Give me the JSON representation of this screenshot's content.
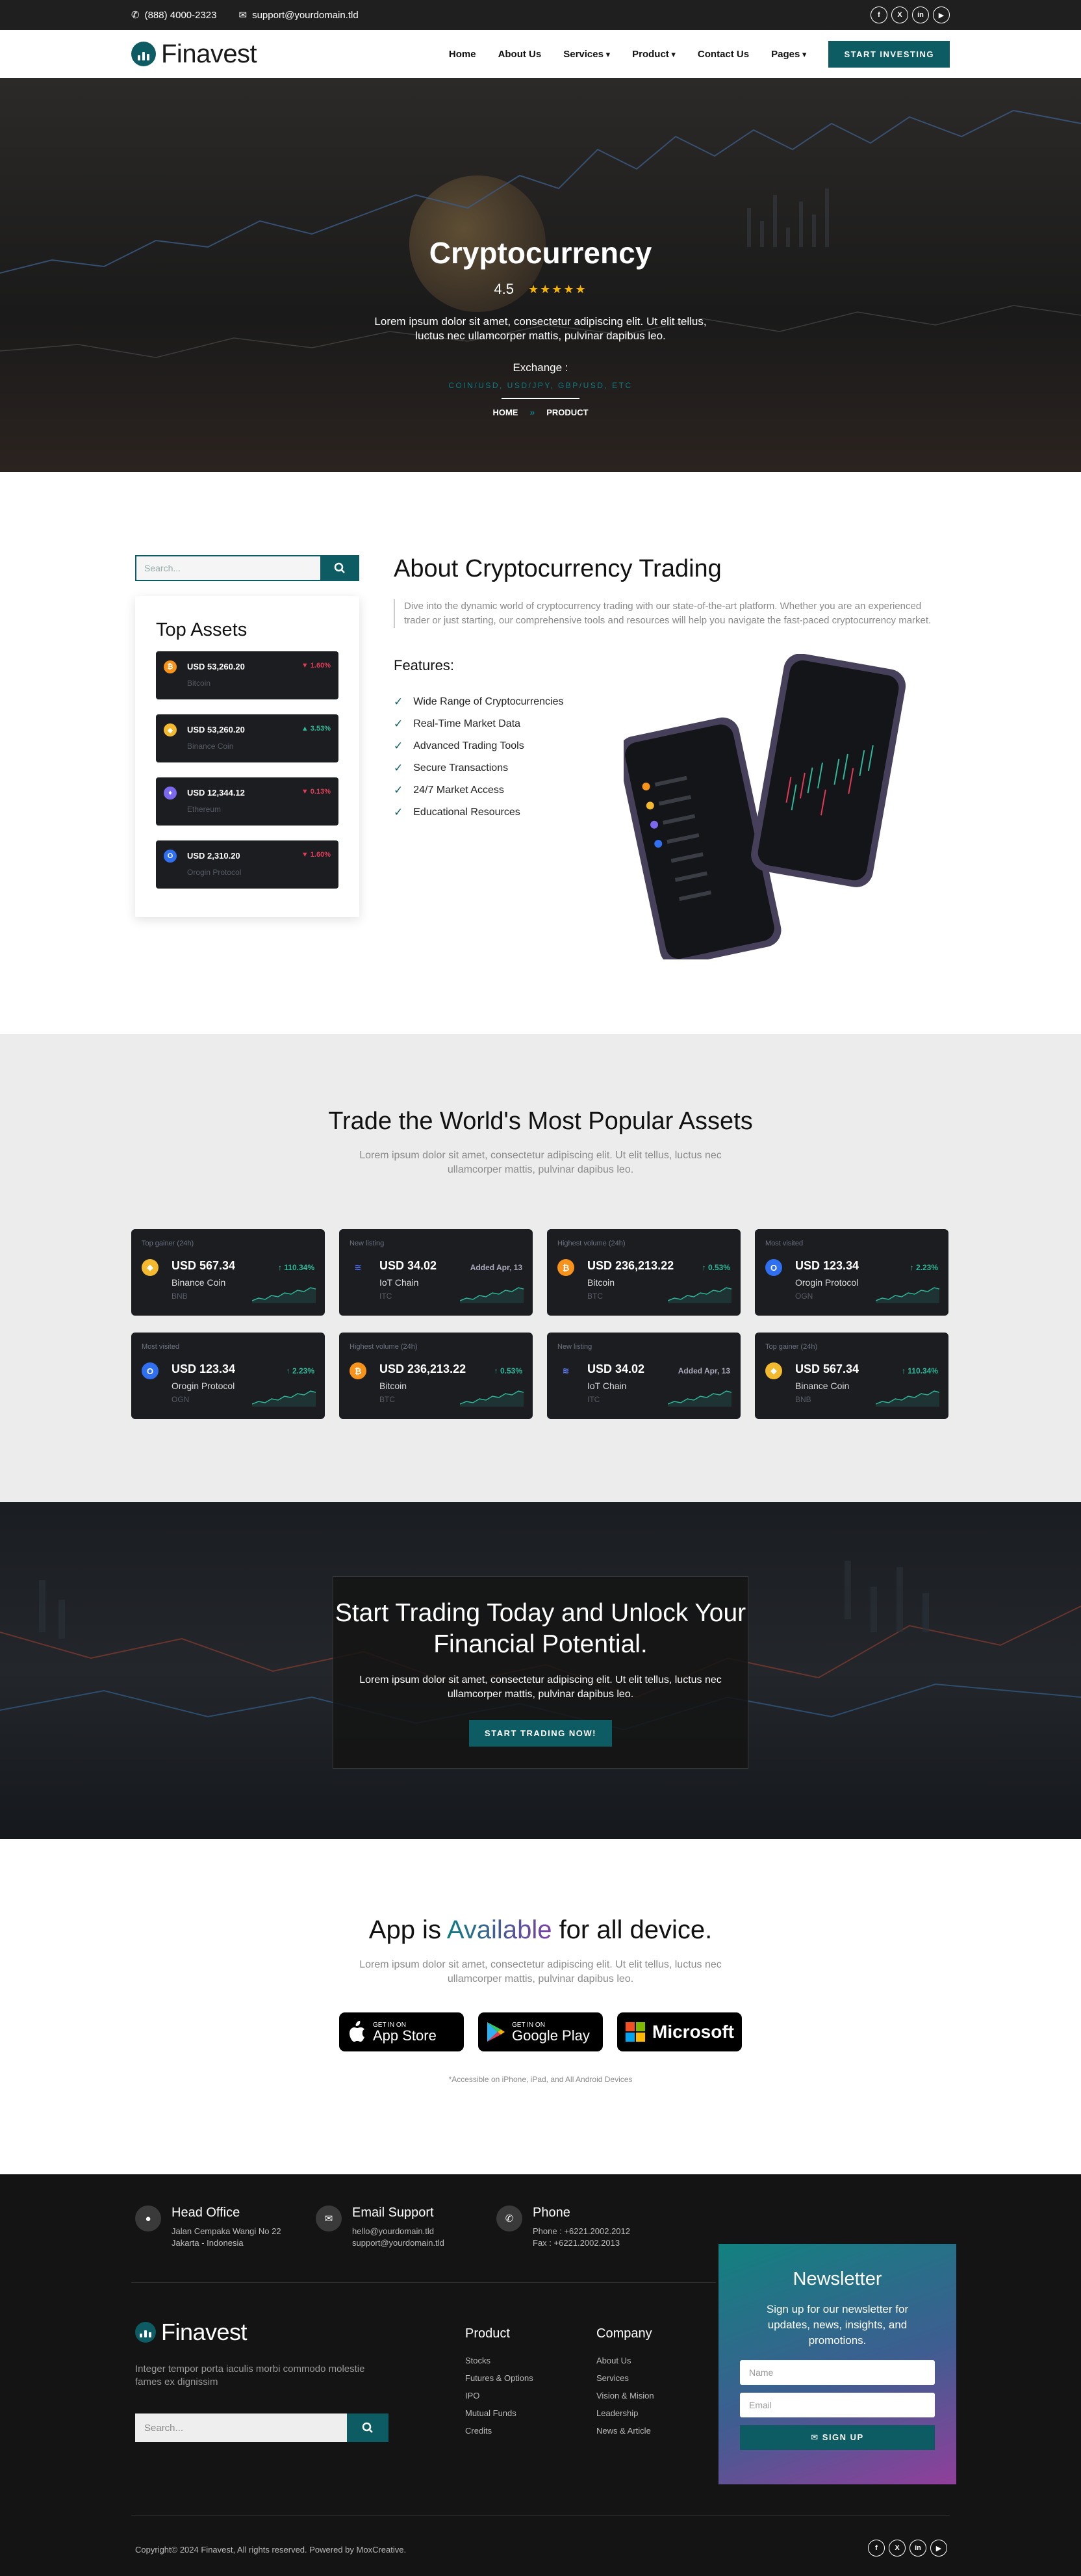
{
  "topbar": {
    "phone": "(888) 4000-2323",
    "email": "support@yourdomain.tld",
    "social": [
      "f",
      "X",
      "in",
      "▶"
    ]
  },
  "nav": {
    "logo": "Finavest",
    "items": [
      "Home",
      "About Us",
      "Services",
      "Product",
      "Contact Us",
      "Pages"
    ],
    "cta": "START INVESTING"
  },
  "hero": {
    "title": "Cryptocurrency",
    "rating": "4.5",
    "stars": "★★★★★",
    "text": "Lorem ipsum dolor sit amet, consectetur adipiscing elit. Ut elit tellus, luctus nec ullamcorper mattis, pulvinar dapibus leo.",
    "exchange_label": "Exchange :",
    "exchange_pairs": "COIN/USD, USD/JPY, GBP/USD, ETC",
    "crumb_home": "HOME",
    "crumb_sep": "»",
    "crumb_current": "PRODUCT"
  },
  "about": {
    "search_placeholder": "Search...",
    "top_assets_title": "Top Assets",
    "assets": [
      {
        "price": "USD 53,260.20",
        "name": "Bitcoin",
        "change": "1.60%",
        "dir": "down",
        "color": "#f7931a",
        "glyph": "₿"
      },
      {
        "price": "USD 53,260.20",
        "name": "Binance Coin",
        "change": "3.53%",
        "dir": "up",
        "color": "#f3ba2f",
        "glyph": "◆"
      },
      {
        "price": "USD 12,344.12",
        "name": "Ethereum",
        "change": "0.13%",
        "dir": "down",
        "color": "#7b68ee",
        "glyph": "♦"
      },
      {
        "price": "USD 2,310.20",
        "name": "Orogin Protocol",
        "change": "1.60%",
        "dir": "down",
        "color": "#2f6ff0",
        "glyph": "O"
      }
    ],
    "title": "About Cryptocurrency Trading",
    "desc": "Dive into the dynamic world of cryptocurrency trading with our state-of-the-art platform. Whether you are an experienced trader or just starting, our comprehensive tools and resources will help you navigate the fast-paced cryptocurrency market.",
    "features_title": "Features:",
    "features": [
      "Wide Range of Cryptocurrencies",
      "Real-Time Market Data",
      "Advanced Trading Tools",
      "Secure Transactions",
      "24/7 Market Access",
      "Educational Resources"
    ]
  },
  "trade": {
    "title": "Trade the World's Most Popular Assets",
    "subtitle": "Lorem ipsum dolor sit amet, consectetur adipiscing elit. Ut elit tellus, luctus nec ullamcorper mattis, pulvinar dapibus leo.",
    "cards": [
      {
        "tag": "Top gainer (24h)",
        "price": "USD 567.34",
        "name": "Binance Coin",
        "sym": "BNB",
        "change": "↑ 110.34%",
        "type": "up",
        "color": "#f3ba2f",
        "glyph": "◆"
      },
      {
        "tag": "New listing",
        "price": "USD 34.02",
        "name": "IoT Chain",
        "sym": "ITC",
        "change": "Added Apr, 13",
        "type": "note",
        "color": "#1c1d21",
        "glyph": "≋"
      },
      {
        "tag": "Highest volume (24h)",
        "price": "USD 236,213.22",
        "name": "Bitcoin",
        "sym": "BTC",
        "change": "↑ 0.53%",
        "type": "up",
        "color": "#f7931a",
        "glyph": "₿"
      },
      {
        "tag": "Most visited",
        "price": "USD 123.34",
        "name": "Orogin Protocol",
        "sym": "OGN",
        "change": "↑ 2.23%",
        "type": "up",
        "color": "#2f6ff0",
        "glyph": "O"
      },
      {
        "tag": "Most visited",
        "price": "USD 123.34",
        "name": "Orogin Protocol",
        "sym": "OGN",
        "change": "↑ 2.23%",
        "type": "up",
        "color": "#2f6ff0",
        "glyph": "O"
      },
      {
        "tag": "Highest volume (24h)",
        "price": "USD 236,213.22",
        "name": "Bitcoin",
        "sym": "BTC",
        "change": "↑ 0.53%",
        "type": "up",
        "color": "#f7931a",
        "glyph": "₿"
      },
      {
        "tag": "New listing",
        "price": "USD 34.02",
        "name": "IoT Chain",
        "sym": "ITC",
        "change": "Added Apr, 13",
        "type": "note",
        "color": "#1c1d21",
        "glyph": "≋"
      },
      {
        "tag": "Top gainer (24h)",
        "price": "USD 567.34",
        "name": "Binance Coin",
        "sym": "BNB",
        "change": "↑ 110.34%",
        "type": "up",
        "color": "#f3ba2f",
        "glyph": "◆"
      }
    ]
  },
  "cta": {
    "title": "Start Trading Today and Unlock Your Financial Potential.",
    "text": "Lorem ipsum dolor sit amet, consectetur adipiscing elit. Ut elit tellus, luctus nec ullamcorper mattis, pulvinar dapibus leo.",
    "button": "START TRADING NOW!"
  },
  "app": {
    "title_pre": "App is ",
    "title_hl": "Available",
    "title_post": " for all device.",
    "subtitle": "Lorem ipsum dolor sit amet, consectetur adipiscing elit. Ut elit tellus, luctus nec ullamcorper mattis, pulvinar dapibus leo.",
    "stores": [
      {
        "small": "GET IN ON",
        "big": "App Store"
      },
      {
        "small": "GET IN ON",
        "big": "Google Play"
      },
      {
        "small": "",
        "big": "Microsoft"
      }
    ],
    "note": "*Accessible on iPhone, iPad, and All Android Devices"
  },
  "footer": {
    "contacts": [
      {
        "title": "Head Office",
        "l1": "Jalan Cempaka Wangi No 22",
        "l2": "Jakarta - Indonesia"
      },
      {
        "title": "Email Support",
        "l1": "hello@yourdomain.tld",
        "l2": "support@yourdomain.tld"
      },
      {
        "title": "Phone",
        "l1": "Phone : +6221.2002.2012",
        "l2": "Fax : +6221.2002.2013"
      }
    ],
    "logo": "Finavest",
    "about": "Integer tempor porta iaculis morbi commodo molestie fames ex dignissim",
    "search_placeholder": "Search...",
    "product_title": "Product",
    "product_links": [
      "Stocks",
      "Futures & Options",
      "IPO",
      "Mutual Funds",
      "Credits"
    ],
    "company_title": "Company",
    "company_links": [
      "About Us",
      "Services",
      "Vision & Mision",
      "Leadership",
      "News & Article"
    ],
    "newsletter": {
      "title": "Newsletter",
      "text": "Sign up for our newsletter for updates, news, insights, and promotions.",
      "name_placeholder": "Name",
      "email_placeholder": "Email",
      "button": "✉ SIGN UP"
    },
    "copyright": "Copyright© 2024 Finavest, All rights reserved. Powered by MoxCreative."
  }
}
